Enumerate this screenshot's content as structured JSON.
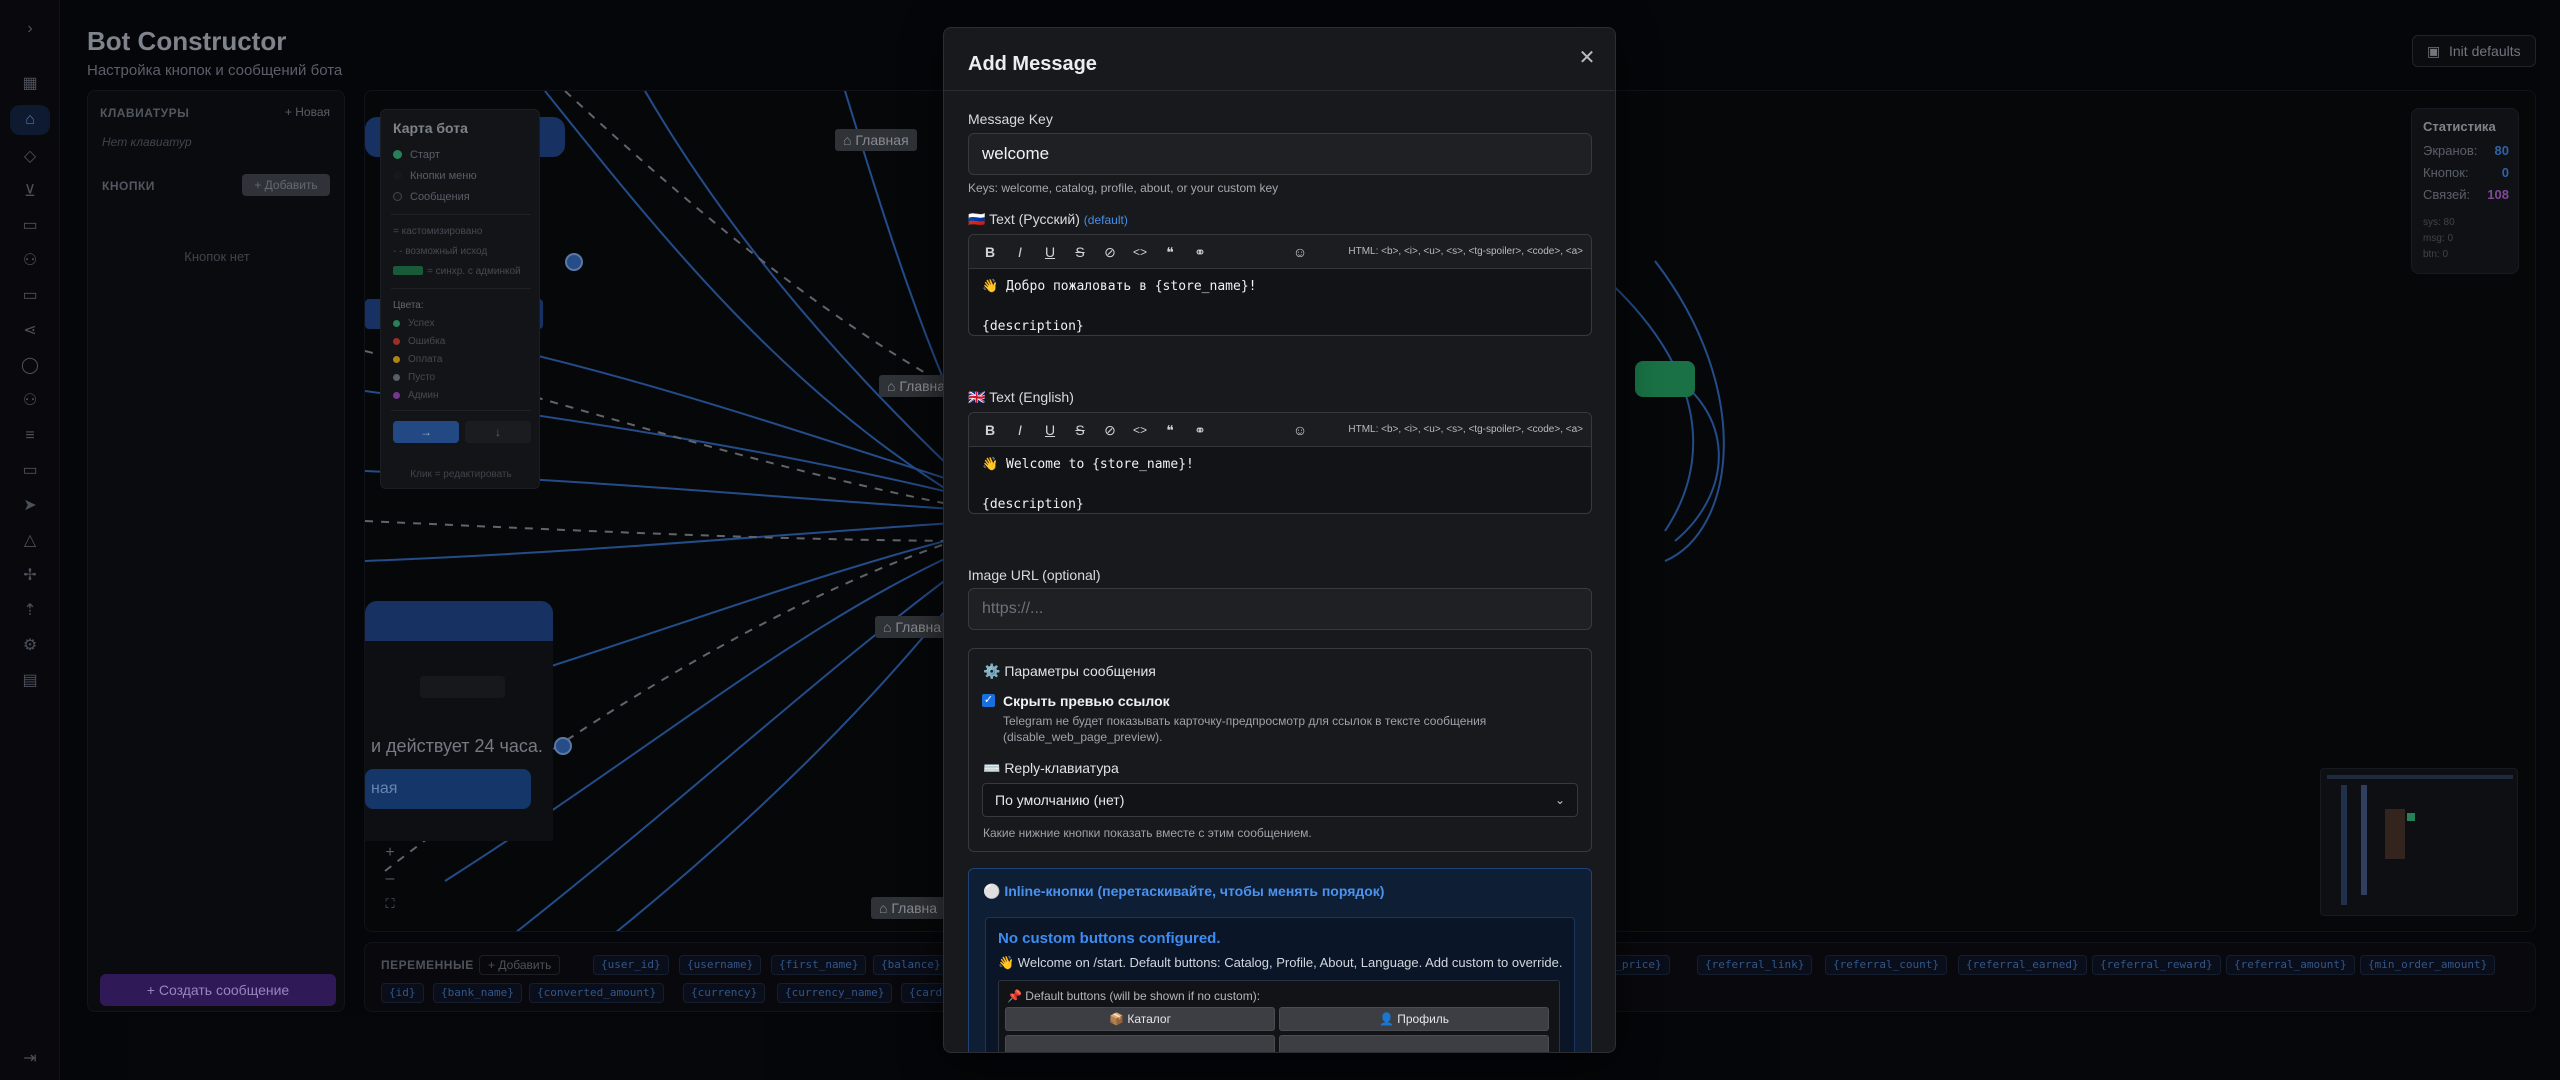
{
  "page": {
    "title": "Bot Constructor",
    "subtitle": "Настройка кнопок и сообщений бота",
    "init_defaults": "Init defaults"
  },
  "rail_icons": [
    "chevron-right-icon",
    "dashboard-icon",
    "bot-icon",
    "package-icon",
    "cart-icon",
    "receipt-icon",
    "users-icon",
    "card-icon",
    "share-icon",
    "globe-icon",
    "user-check-icon",
    "database-icon",
    "wallet-icon",
    "send-icon",
    "bell-icon",
    "puzzle-icon",
    "upload-icon",
    "settings-icon",
    "document-icon",
    "logout-icon"
  ],
  "left_panel": {
    "keyboards_header": "КЛАВИАТУРЫ",
    "new_label": "+ Новая",
    "no_keyboards": "Нет клавиатур",
    "buttons_header": "КНОПКИ",
    "add_label": "+ Добавить",
    "no_buttons": "Кнопок нет",
    "create_message": "+ Создать сообщение"
  },
  "canvas": {
    "chips": [
      "Главная",
      "Главна",
      "Главна",
      "Главна"
    ],
    "card_text": "и действует 24 часа.",
    "card_button": "ная",
    "zoom_in": "+",
    "zoom_out": "–",
    "fit": "⛶"
  },
  "bot_map": {
    "title": "Карта бота",
    "legend": [
      {
        "label": "Старт",
        "color": "#2e9e6b"
      },
      {
        "label": "Кнопки меню",
        "color": "#1c1e22"
      },
      {
        "label": "Сообщения",
        "color": "#1c1e22"
      }
    ],
    "notes": [
      "= кастомизировано",
      "- - возможный исход",
      "= синхр. с админкой"
    ],
    "colors_title": "Цвета:",
    "colors": [
      {
        "label": "Успех",
        "color": "#2e9e6b"
      },
      {
        "label": "Ошибка",
        "color": "#c0392b"
      },
      {
        "label": "Оплата",
        "color": "#d4a017"
      },
      {
        "label": "Пусто",
        "color": "#6b7280"
      },
      {
        "label": "Админ",
        "color": "#8e44ad"
      }
    ],
    "btn_right": "→",
    "btn_down": "↓",
    "hint": "Клик = редактировать"
  },
  "stats": {
    "title": "Статистика",
    "rows": [
      {
        "label": "Экранов:",
        "value": "80",
        "color": "#3d78c9"
      },
      {
        "label": "Кнопок:",
        "value": "0",
        "color": "#3d78c9"
      },
      {
        "label": "Связей:",
        "value": "108",
        "color": "#9b59b6"
      }
    ],
    "small": [
      "sys: 80",
      "msg: 0",
      "btn: 0"
    ]
  },
  "variables": {
    "label": "ПЕРЕМЕННЫЕ",
    "add": "+ Добавить",
    "row1": [
      "{user_id}",
      "{username}",
      "{first_name}",
      "{balance}"
    ],
    "row1_right": [
      "al_price}",
      "{referral_link}",
      "{referral_count}",
      "{referral_earned}",
      "{referral_reward}",
      "{referral_amount}",
      "{min_order_amount}"
    ],
    "row2": [
      "{id}",
      "{bank_name}",
      "{converted_amount}",
      "{currency}",
      "{currency_name}",
      "{card"
    ]
  },
  "modal": {
    "title": "Add Message",
    "close": "✕",
    "message_key_label": "Message Key",
    "message_key_value": "welcome",
    "message_key_hint": "Keys: welcome, catalog, profile, about, or your custom key",
    "text_ru_label": "🇷🇺 Text (Русский)",
    "text_ru_default": "(default)",
    "text_en_label": "🇬🇧 Text (English)",
    "editor_hint": "HTML: <b>, <i>, <u>, <s>, <tg-spoiler>, <code>, <a>",
    "ru_lines": [
      "👋 Добро пожаловать в {store_name}!",
      "{description}"
    ],
    "en_lines": [
      "👋 Welcome to {store_name}!",
      "{description}"
    ],
    "image_url_label": "Image URL (optional)",
    "image_url_placeholder": "https://...",
    "params_title": "⚙️ Параметры сообщения",
    "hide_preview_label": "Скрыть превью ссылок",
    "hide_preview_desc": "Telegram не будет показывать карточку-предпросмотр для ссылок в тексте сообщения (disable_web_page_preview).",
    "reply_kb_title": "⌨️ Reply-клавиатура",
    "reply_kb_value": "По умолчанию (нет)",
    "reply_kb_hint": "Какие нижние кнопки показать вместе с этим сообщением.",
    "inline_title": "⚪ Inline-кнопки (перетаскивайте, чтобы менять порядок)",
    "no_custom": "No custom buttons configured.",
    "no_custom_desc": "👋 Welcome on /start. Default buttons: Catalog, Profile, About, Language. Add custom to override.",
    "default_buttons_title": "📌 Default buttons (will be shown if no custom):",
    "default_buttons": [
      "📦 Каталог",
      "👤 Профиль"
    ]
  }
}
